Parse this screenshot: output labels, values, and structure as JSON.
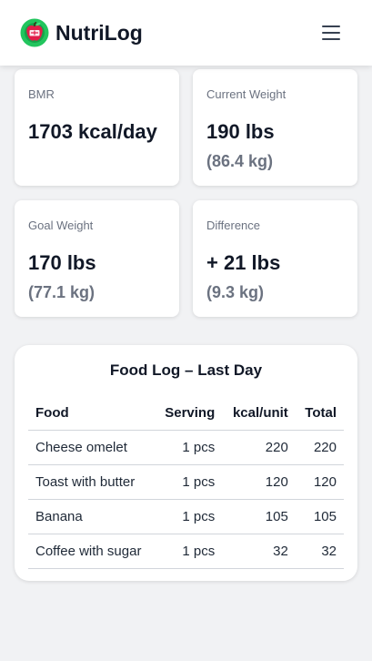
{
  "header": {
    "app_name": "NutriLog",
    "logo_icon": "apple-logo-icon",
    "menu_icon": "hamburger-menu-icon"
  },
  "stats": {
    "bmr": {
      "label": "BMR",
      "value": "1703 kcal/day"
    },
    "current_weight": {
      "label": "Current Weight",
      "value": "190 lbs",
      "sub": "(86.4 kg)"
    },
    "goal_weight": {
      "label": "Goal Weight",
      "value": "170 lbs",
      "sub": "(77.1 kg)"
    },
    "difference": {
      "label": "Difference",
      "value": "+ 21 lbs",
      "sub": "(9.3 kg)"
    }
  },
  "food_log": {
    "title": "Food Log – Last Day",
    "columns": {
      "food": "Food",
      "serving": "Serving",
      "kcal_unit": "kcal/unit",
      "total": "Total"
    },
    "rows": [
      {
        "food": "Cheese omelet",
        "serving": "1 pcs",
        "kcal_unit": "220",
        "total": "220"
      },
      {
        "food": "Toast with butter",
        "serving": "1 pcs",
        "kcal_unit": "120",
        "total": "120"
      },
      {
        "food": "Banana",
        "serving": "1 pcs",
        "kcal_unit": "105",
        "total": "105"
      },
      {
        "food": "Coffee with sugar",
        "serving": "1 pcs",
        "kcal_unit": "32",
        "total": "32"
      }
    ]
  },
  "colors": {
    "background": "#f1f2f4",
    "card": "#ffffff",
    "text_primary": "#111827",
    "text_muted": "#6b7280",
    "logo_green": "#22c55e",
    "logo_red": "#e11d48"
  }
}
